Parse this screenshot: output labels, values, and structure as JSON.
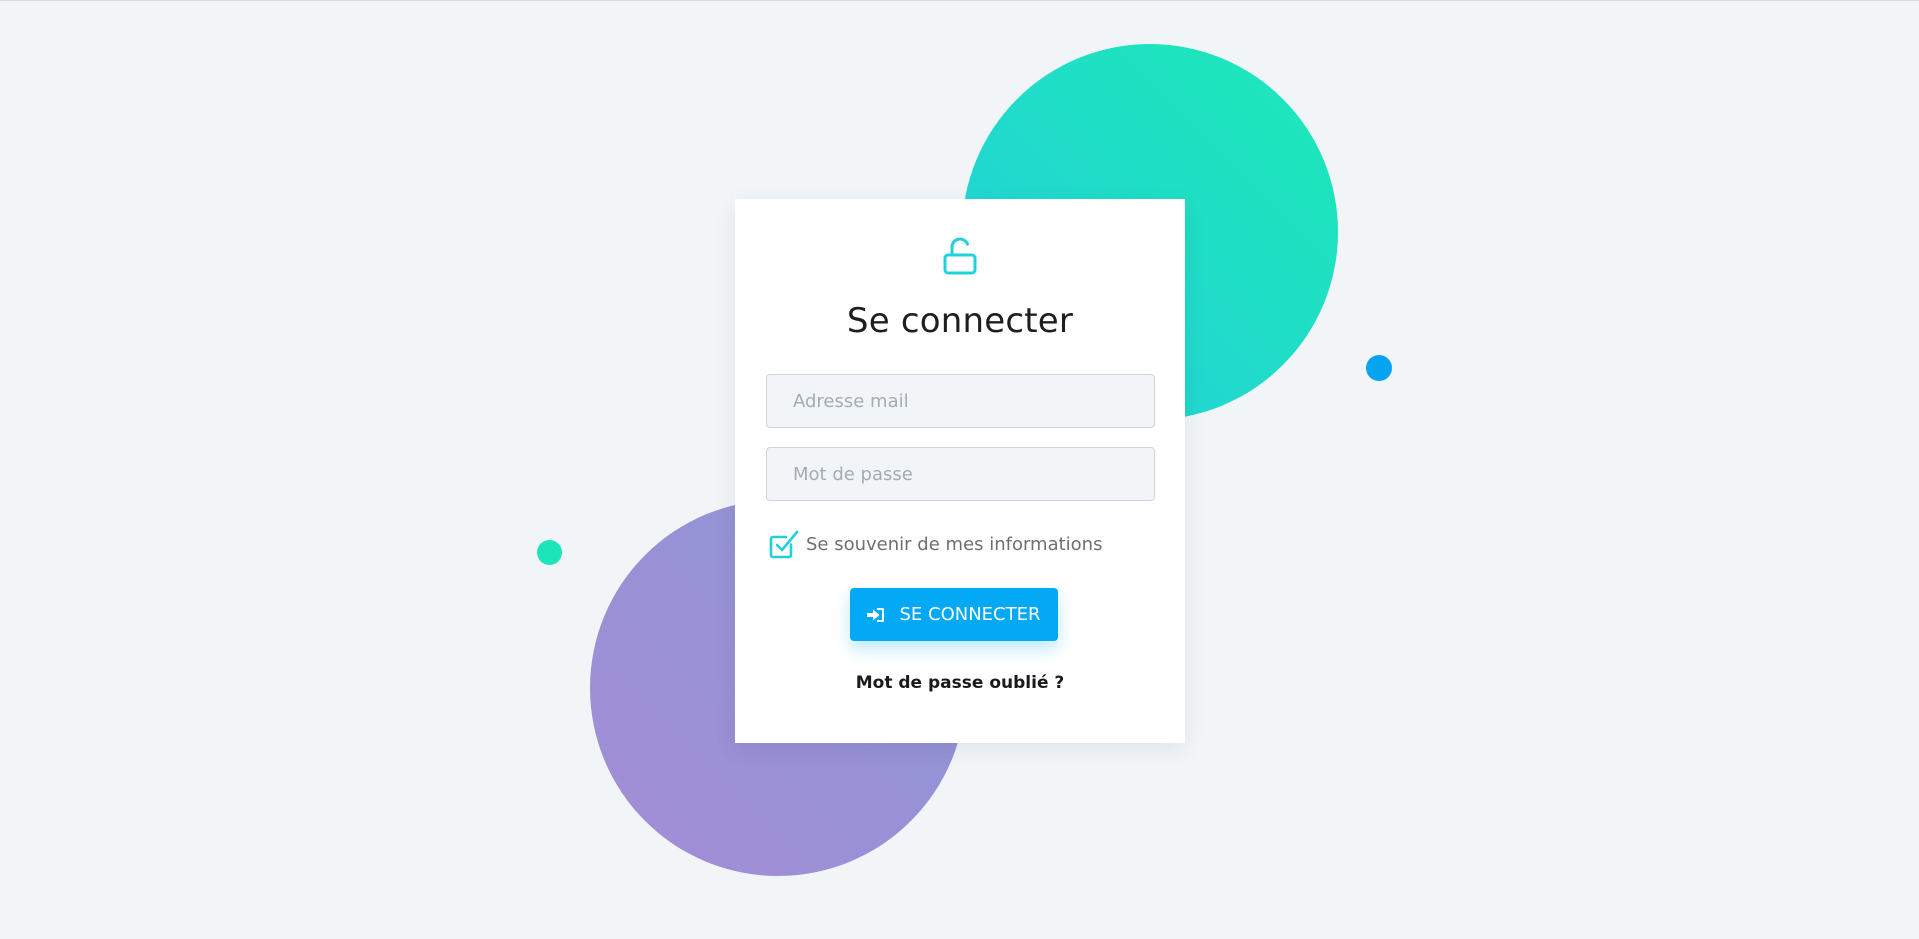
{
  "login": {
    "title": "Se connecter",
    "email_placeholder": "Adresse mail",
    "password_placeholder": "Mot de passe",
    "remember_label": "Se souvenir de mes informations",
    "remember_checked": true,
    "submit_label": "SE CONNECTER",
    "forgot_label": "Mot de passe oublié ?"
  },
  "icons": {
    "header": "unlock-icon",
    "checkbox": "checkbox-checked-icon",
    "submit": "sign-in-icon"
  },
  "colors": {
    "background": "#f2f5f8",
    "accent_teal": "#22d0dc",
    "button_blue": "#03a9f4",
    "bubble_green": "#1de9b6",
    "bubble_purple": "#a38dd6"
  }
}
